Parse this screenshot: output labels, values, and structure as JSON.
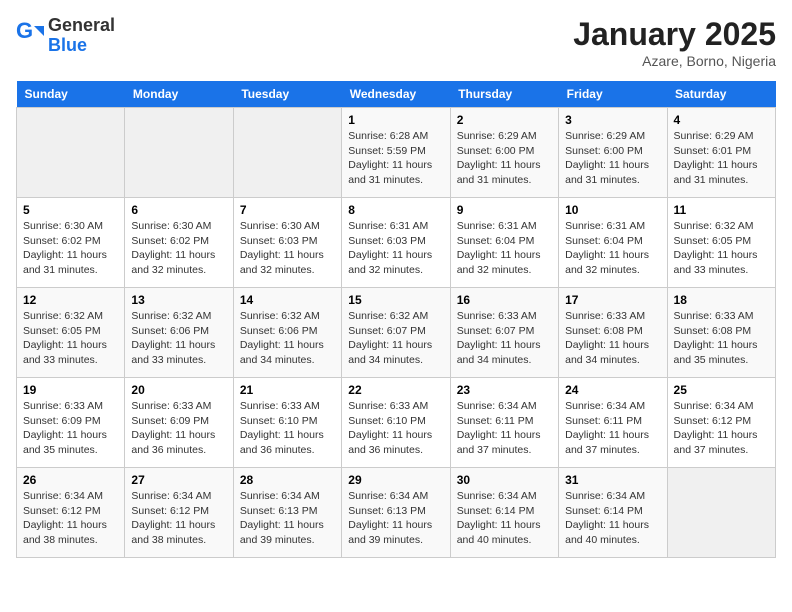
{
  "header": {
    "logo_general": "General",
    "logo_blue": "Blue",
    "calendar_title": "January 2025",
    "calendar_subtitle": "Azare, Borno, Nigeria"
  },
  "weekdays": [
    "Sunday",
    "Monday",
    "Tuesday",
    "Wednesday",
    "Thursday",
    "Friday",
    "Saturday"
  ],
  "weeks": [
    [
      {
        "day": "",
        "info": ""
      },
      {
        "day": "",
        "info": ""
      },
      {
        "day": "",
        "info": ""
      },
      {
        "day": "1",
        "info": "Sunrise: 6:28 AM\nSunset: 5:59 PM\nDaylight: 11 hours and 31 minutes."
      },
      {
        "day": "2",
        "info": "Sunrise: 6:29 AM\nSunset: 6:00 PM\nDaylight: 11 hours and 31 minutes."
      },
      {
        "day": "3",
        "info": "Sunrise: 6:29 AM\nSunset: 6:00 PM\nDaylight: 11 hours and 31 minutes."
      },
      {
        "day": "4",
        "info": "Sunrise: 6:29 AM\nSunset: 6:01 PM\nDaylight: 11 hours and 31 minutes."
      }
    ],
    [
      {
        "day": "5",
        "info": "Sunrise: 6:30 AM\nSunset: 6:02 PM\nDaylight: 11 hours and 31 minutes."
      },
      {
        "day": "6",
        "info": "Sunrise: 6:30 AM\nSunset: 6:02 PM\nDaylight: 11 hours and 32 minutes."
      },
      {
        "day": "7",
        "info": "Sunrise: 6:30 AM\nSunset: 6:03 PM\nDaylight: 11 hours and 32 minutes."
      },
      {
        "day": "8",
        "info": "Sunrise: 6:31 AM\nSunset: 6:03 PM\nDaylight: 11 hours and 32 minutes."
      },
      {
        "day": "9",
        "info": "Sunrise: 6:31 AM\nSunset: 6:04 PM\nDaylight: 11 hours and 32 minutes."
      },
      {
        "day": "10",
        "info": "Sunrise: 6:31 AM\nSunset: 6:04 PM\nDaylight: 11 hours and 32 minutes."
      },
      {
        "day": "11",
        "info": "Sunrise: 6:32 AM\nSunset: 6:05 PM\nDaylight: 11 hours and 33 minutes."
      }
    ],
    [
      {
        "day": "12",
        "info": "Sunrise: 6:32 AM\nSunset: 6:05 PM\nDaylight: 11 hours and 33 minutes."
      },
      {
        "day": "13",
        "info": "Sunrise: 6:32 AM\nSunset: 6:06 PM\nDaylight: 11 hours and 33 minutes."
      },
      {
        "day": "14",
        "info": "Sunrise: 6:32 AM\nSunset: 6:06 PM\nDaylight: 11 hours and 34 minutes."
      },
      {
        "day": "15",
        "info": "Sunrise: 6:32 AM\nSunset: 6:07 PM\nDaylight: 11 hours and 34 minutes."
      },
      {
        "day": "16",
        "info": "Sunrise: 6:33 AM\nSunset: 6:07 PM\nDaylight: 11 hours and 34 minutes."
      },
      {
        "day": "17",
        "info": "Sunrise: 6:33 AM\nSunset: 6:08 PM\nDaylight: 11 hours and 34 minutes."
      },
      {
        "day": "18",
        "info": "Sunrise: 6:33 AM\nSunset: 6:08 PM\nDaylight: 11 hours and 35 minutes."
      }
    ],
    [
      {
        "day": "19",
        "info": "Sunrise: 6:33 AM\nSunset: 6:09 PM\nDaylight: 11 hours and 35 minutes."
      },
      {
        "day": "20",
        "info": "Sunrise: 6:33 AM\nSunset: 6:09 PM\nDaylight: 11 hours and 36 minutes."
      },
      {
        "day": "21",
        "info": "Sunrise: 6:33 AM\nSunset: 6:10 PM\nDaylight: 11 hours and 36 minutes."
      },
      {
        "day": "22",
        "info": "Sunrise: 6:33 AM\nSunset: 6:10 PM\nDaylight: 11 hours and 36 minutes."
      },
      {
        "day": "23",
        "info": "Sunrise: 6:34 AM\nSunset: 6:11 PM\nDaylight: 11 hours and 37 minutes."
      },
      {
        "day": "24",
        "info": "Sunrise: 6:34 AM\nSunset: 6:11 PM\nDaylight: 11 hours and 37 minutes."
      },
      {
        "day": "25",
        "info": "Sunrise: 6:34 AM\nSunset: 6:12 PM\nDaylight: 11 hours and 37 minutes."
      }
    ],
    [
      {
        "day": "26",
        "info": "Sunrise: 6:34 AM\nSunset: 6:12 PM\nDaylight: 11 hours and 38 minutes."
      },
      {
        "day": "27",
        "info": "Sunrise: 6:34 AM\nSunset: 6:12 PM\nDaylight: 11 hours and 38 minutes."
      },
      {
        "day": "28",
        "info": "Sunrise: 6:34 AM\nSunset: 6:13 PM\nDaylight: 11 hours and 39 minutes."
      },
      {
        "day": "29",
        "info": "Sunrise: 6:34 AM\nSunset: 6:13 PM\nDaylight: 11 hours and 39 minutes."
      },
      {
        "day": "30",
        "info": "Sunrise: 6:34 AM\nSunset: 6:14 PM\nDaylight: 11 hours and 40 minutes."
      },
      {
        "day": "31",
        "info": "Sunrise: 6:34 AM\nSunset: 6:14 PM\nDaylight: 11 hours and 40 minutes."
      },
      {
        "day": "",
        "info": ""
      }
    ]
  ]
}
